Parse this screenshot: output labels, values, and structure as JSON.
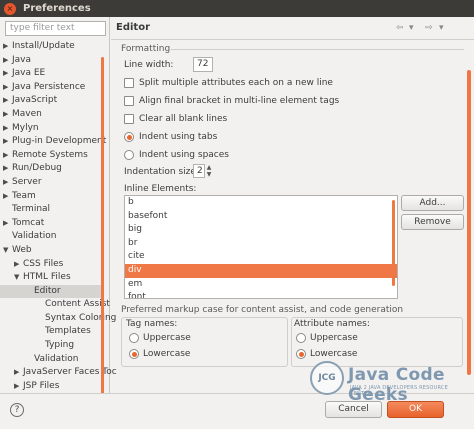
{
  "window": {
    "title": "Preferences",
    "close_glyph": "×"
  },
  "left": {
    "filter_placeholder": "type filter text",
    "tree": [
      {
        "label": "Install/Update",
        "indent": 0,
        "arrow": "▶"
      },
      {
        "label": "Java",
        "indent": 0,
        "arrow": "▶"
      },
      {
        "label": "Java EE",
        "indent": 0,
        "arrow": "▶"
      },
      {
        "label": "Java Persistence",
        "indent": 0,
        "arrow": "▶"
      },
      {
        "label": "JavaScript",
        "indent": 0,
        "arrow": "▶"
      },
      {
        "label": "Maven",
        "indent": 0,
        "arrow": "▶"
      },
      {
        "label": "Mylyn",
        "indent": 0,
        "arrow": "▶"
      },
      {
        "label": "Plug-in Development",
        "indent": 0,
        "arrow": "▶"
      },
      {
        "label": "Remote Systems",
        "indent": 0,
        "arrow": "▶"
      },
      {
        "label": "Run/Debug",
        "indent": 0,
        "arrow": "▶"
      },
      {
        "label": "Server",
        "indent": 0,
        "arrow": "▶"
      },
      {
        "label": "Team",
        "indent": 0,
        "arrow": "▶"
      },
      {
        "label": "Terminal",
        "indent": 0,
        "arrow": ""
      },
      {
        "label": "Tomcat",
        "indent": 0,
        "arrow": "▶"
      },
      {
        "label": "Validation",
        "indent": 0,
        "arrow": ""
      },
      {
        "label": "Web",
        "indent": 0,
        "arrow": "▼"
      },
      {
        "label": "CSS Files",
        "indent": 1,
        "arrow": "▶"
      },
      {
        "label": "HTML Files",
        "indent": 1,
        "arrow": "▼"
      },
      {
        "label": "Editor",
        "indent": 2,
        "arrow": "",
        "selected": true
      },
      {
        "label": "Content Assist",
        "indent": 3,
        "arrow": ""
      },
      {
        "label": "Syntax Coloring",
        "indent": 3,
        "arrow": ""
      },
      {
        "label": "Templates",
        "indent": 3,
        "arrow": ""
      },
      {
        "label": "Typing",
        "indent": 3,
        "arrow": ""
      },
      {
        "label": "Validation",
        "indent": 2,
        "arrow": ""
      },
      {
        "label": "JavaServer Faces Toc",
        "indent": 1,
        "arrow": "▶"
      },
      {
        "label": "JSP Files",
        "indent": 1,
        "arrow": "▶"
      }
    ]
  },
  "editor": {
    "title": "Editor",
    "nav": {
      "back": "⇦",
      "back_menu": "▾",
      "forward": "⇨",
      "forward_menu": "▾"
    },
    "formatting_legend": "Formatting",
    "line_width_label": "Line width:",
    "line_width_value": "72",
    "split_attrs_label": "Split multiple attributes each on a new line",
    "align_bracket_label": "Align final bracket in multi-line element tags",
    "clear_blank_label": "Clear all blank lines",
    "indent_tabs_label": "Indent using tabs",
    "indent_spaces_label": "Indent using spaces",
    "indent_size_label": "Indentation size:",
    "indent_size_value": "2",
    "spin_up": "▲",
    "spin_down": "▼",
    "inline_label": "Inline Elements:",
    "inline_items": [
      "b",
      "basefont",
      "big",
      "br",
      "cite",
      "div",
      "em",
      "font"
    ],
    "inline_selected_index": 5,
    "add_button": "Add...",
    "remove_button": "Remove",
    "pref_legend": "Preferred markup case for content assist, and code generation",
    "tag_names": {
      "title": "Tag names:",
      "upper": "Uppercase",
      "lower": "Lowercase"
    },
    "attr_names": {
      "title": "Attribute names:",
      "upper": "Uppercase",
      "lower": "Lowercase"
    }
  },
  "buttons": {
    "help": "?",
    "cancel": "Cancel",
    "ok": "OK"
  },
  "watermark": {
    "logo": "JCG",
    "name": "Java Code Geeks",
    "tagline": "JAVA 2 JAVA DEVELOPERS RESOURCE CENTER"
  },
  "colors": {
    "accent": "#f07746",
    "titlebar": "#3c3b37",
    "panel": "#f2f1f0"
  }
}
